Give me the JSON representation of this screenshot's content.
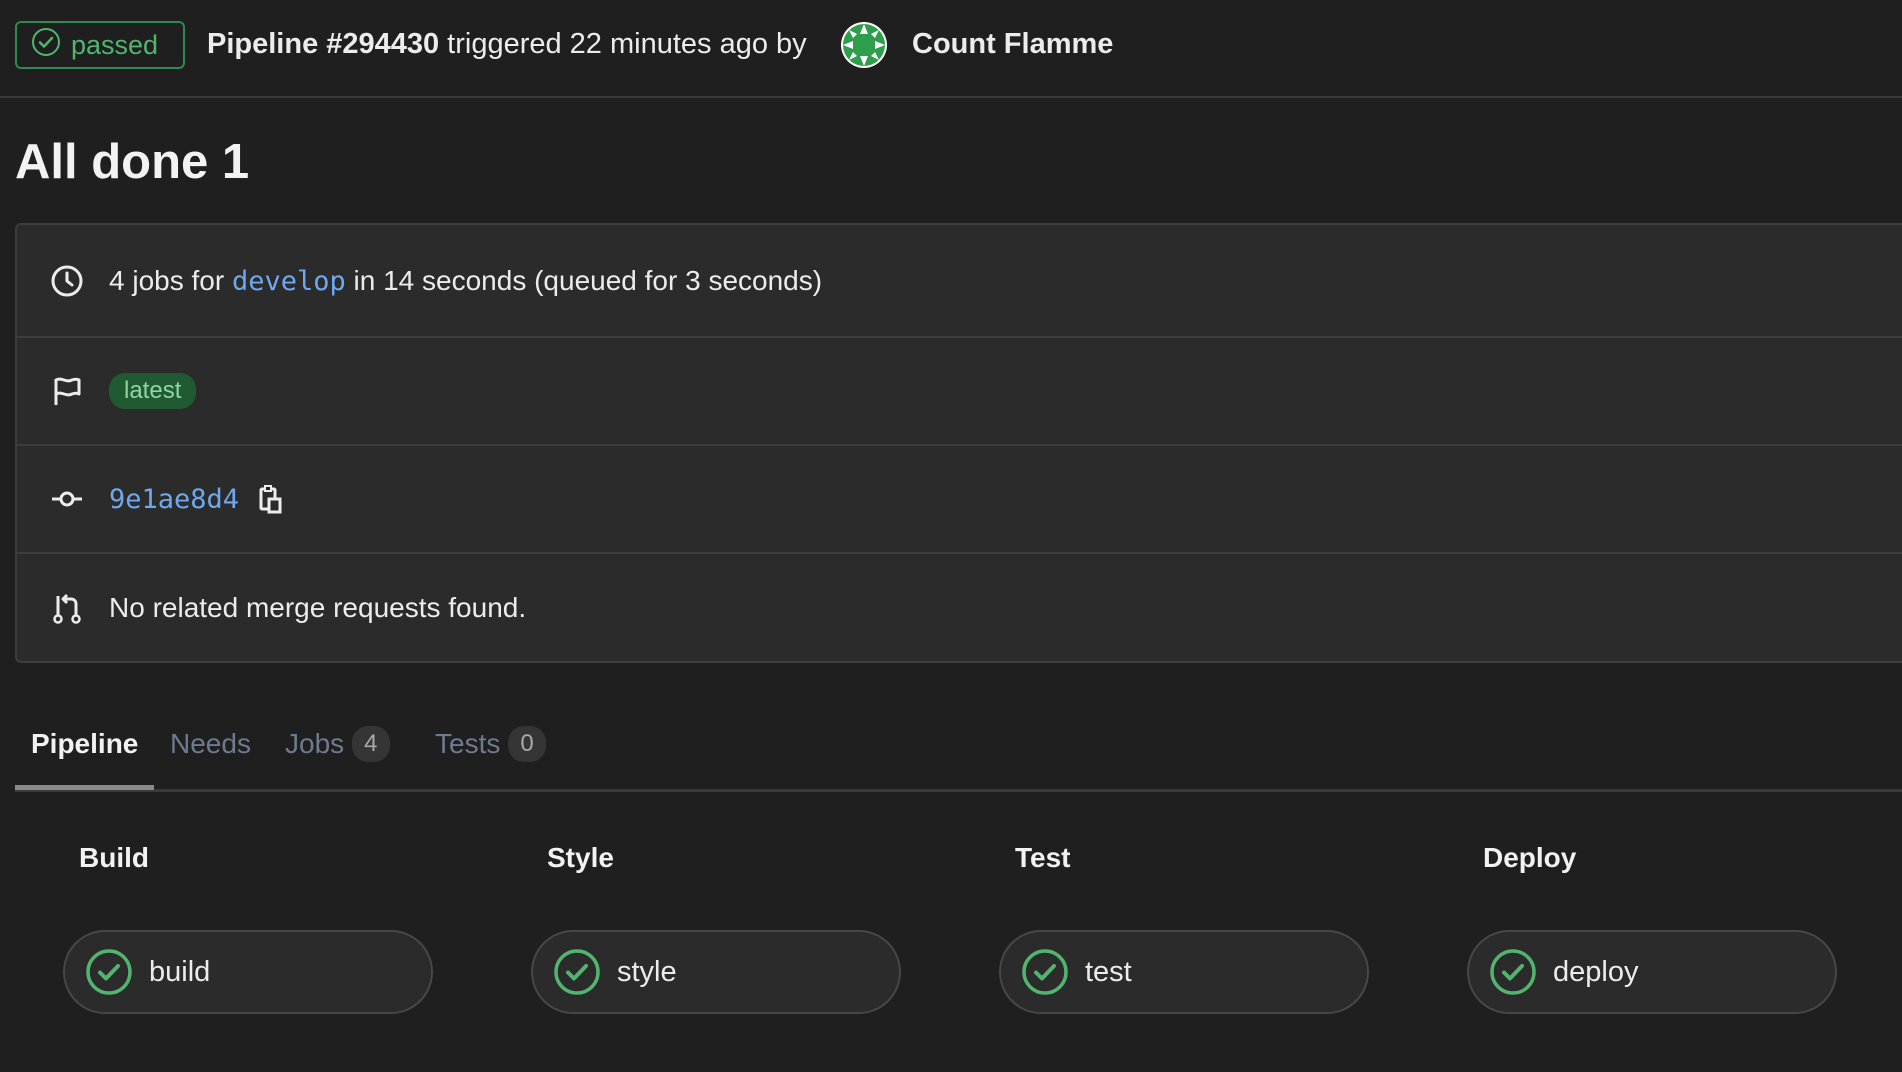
{
  "header": {
    "status": "passed",
    "pipeline_label": "Pipeline #294430",
    "triggered_text": "triggered 22 minutes ago by",
    "author": "Count Flamme"
  },
  "title": "All done 1",
  "info": {
    "jobs_prefix": "4 jobs for",
    "branch": "develop",
    "jobs_suffix": "in 14 seconds (queued for 3 seconds)",
    "tag": "latest",
    "commit": "9e1ae8d4",
    "merge_requests": "No related merge requests found."
  },
  "tabs": [
    {
      "label": "Pipeline"
    },
    {
      "label": "Needs"
    },
    {
      "label": "Jobs",
      "count": "4"
    },
    {
      "label": "Tests",
      "count": "0"
    }
  ],
  "stages": [
    {
      "title": "Build",
      "job": "build"
    },
    {
      "title": "Style",
      "job": "style"
    },
    {
      "title": "Test",
      "job": "test"
    },
    {
      "title": "Deploy",
      "job": "deploy"
    }
  ],
  "colors": {
    "success": "#52b56e",
    "link": "#6ea8ef",
    "background": "#1f1f1f",
    "card": "#2b2b2b"
  }
}
